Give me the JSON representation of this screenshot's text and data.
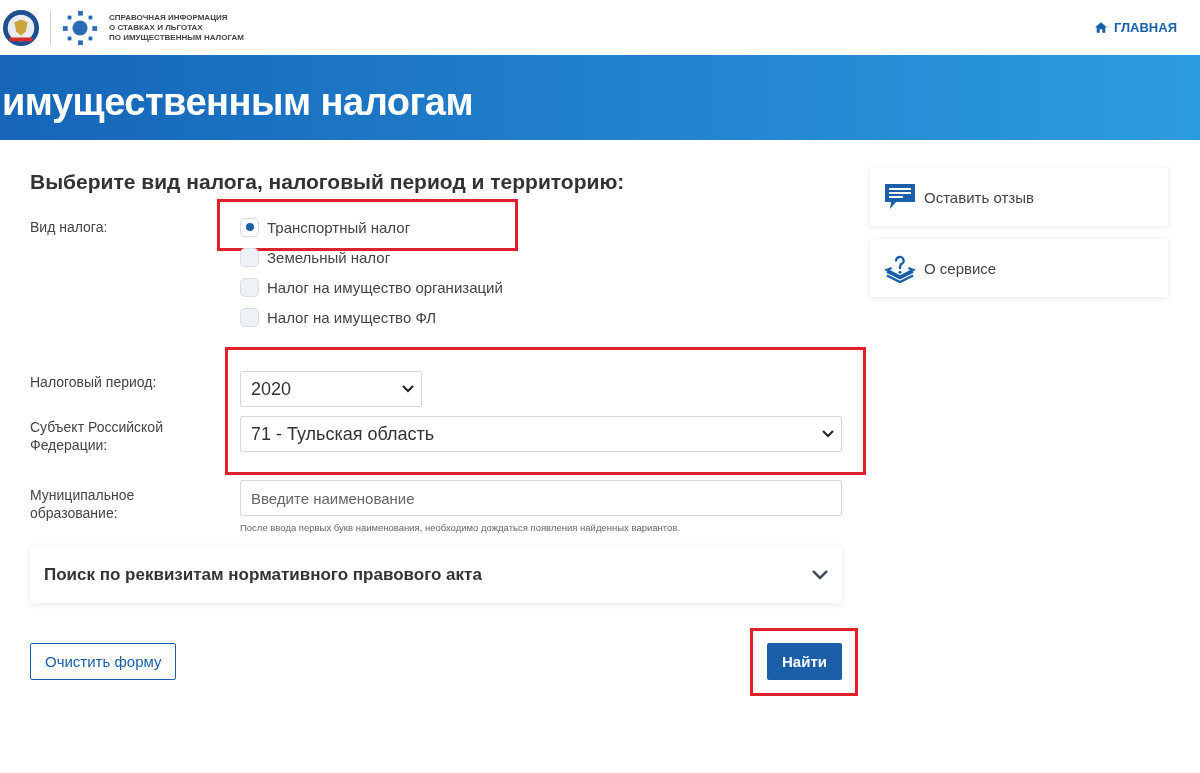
{
  "header": {
    "logo_text": [
      "СПРАВОЧНАЯ ИНФОРМАЦИЯ",
      "О СТАВКАХ И ЛЬГОТАХ",
      "ПО ИМУЩЕСТВЕННЫМ НАЛОГАМ"
    ],
    "nav_link": "ГЛАВНАЯ"
  },
  "banner": {
    "title": "имущественным налогам"
  },
  "form": {
    "heading": "Выберите вид налога, налоговый период и территорию:",
    "tax_type": {
      "label": "Вид налога:",
      "options": [
        {
          "label": "Транспортный налог",
          "selected": true,
          "highlighted": true
        },
        {
          "label": "Земельный налог",
          "selected": false,
          "highlighted": false
        },
        {
          "label": "Налог на имущество организаций",
          "selected": false,
          "highlighted": false
        },
        {
          "label": "Налог на имущество ФЛ",
          "selected": false,
          "highlighted": false
        }
      ]
    },
    "selects_highlighted": true,
    "period": {
      "label": "Налоговый период:",
      "value": "2020"
    },
    "subject": {
      "label": "Субъект Российской Федерации:",
      "value": "71 - Тульская область"
    },
    "municipality": {
      "label": "Муниципальное образование:",
      "placeholder": "Введите наименование",
      "hint": "После ввода первых букв наименования, необходимо дождаться появления найденных вариантов."
    },
    "accordion": {
      "title": "Поиск по реквизитам нормативного правового акта",
      "expanded": false
    },
    "clear_button": "Очистить форму",
    "find_button": {
      "label": "Найти",
      "highlighted": true
    }
  },
  "side_links": [
    {
      "kind": "feedback",
      "label": "Оставить отзыв"
    },
    {
      "kind": "about",
      "label": "О сервисе"
    }
  ]
}
